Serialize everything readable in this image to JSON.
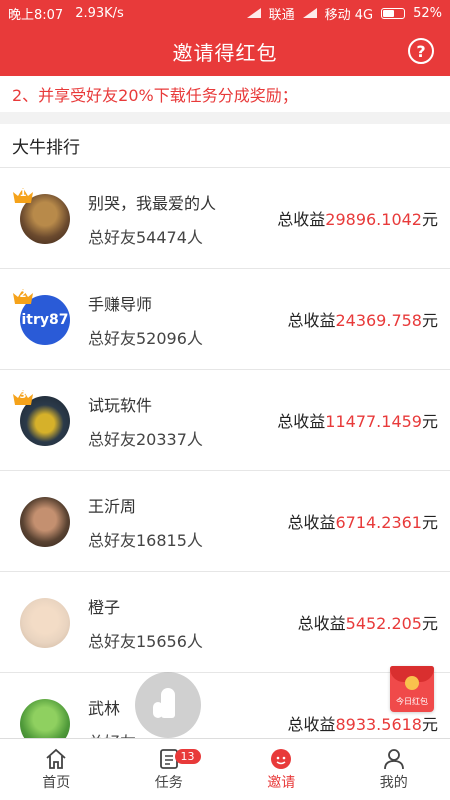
{
  "status_bar": {
    "time": "晚上8:07",
    "speed": "2.93K/s",
    "carrier1": "联通",
    "carrier2": "移动 4G",
    "battery": "52%"
  },
  "header": {
    "title": "邀请得红包",
    "help_icon": "help-circle-icon"
  },
  "rules": {
    "line2": "2、并享受好友20%下载任务分成奖励；"
  },
  "ranking": {
    "section_title": "大牛排行",
    "total_earnings_label": "总收益",
    "currency_unit": "元",
    "items": [
      {
        "rank": "1",
        "name": "别哭，我最爱的人",
        "friends": "总好友54474人",
        "amount": "29896.1042",
        "avatar_color": "#6b4a2e"
      },
      {
        "rank": "2",
        "name": "手赚导师",
        "friends": "总好友52096人",
        "amount": "24369.758",
        "avatar_color": "#2a5bd7",
        "avatar_text": "itry87"
      },
      {
        "rank": "3",
        "name": "试玩软件",
        "friends": "总好友20337人",
        "amount": "11477.1459",
        "avatar_color": "#2b3a4a"
      },
      {
        "rank": "",
        "name": "王沂周",
        "friends": "总好友16815人",
        "amount": "6714.2361",
        "avatar_color": "#5a4332"
      },
      {
        "rank": "",
        "name": "橙子",
        "friends": "总好友15656人",
        "amount": "5452.205",
        "avatar_color": "#e9d4c0"
      },
      {
        "rank": "",
        "name": "武林",
        "friends": "总好友",
        "amount": "8933.5618",
        "avatar_color": "#4f9a3a"
      }
    ]
  },
  "redpacket": {
    "label": "今日红包"
  },
  "tabbar": {
    "tabs": [
      {
        "label": "首页",
        "icon": "home-icon"
      },
      {
        "label": "任务",
        "icon": "task-icon",
        "badge": "13"
      },
      {
        "label": "邀请",
        "icon": "invite-icon"
      },
      {
        "label": "我的",
        "icon": "profile-icon"
      }
    ]
  },
  "colors": {
    "brand_red": "#e83a3a"
  }
}
